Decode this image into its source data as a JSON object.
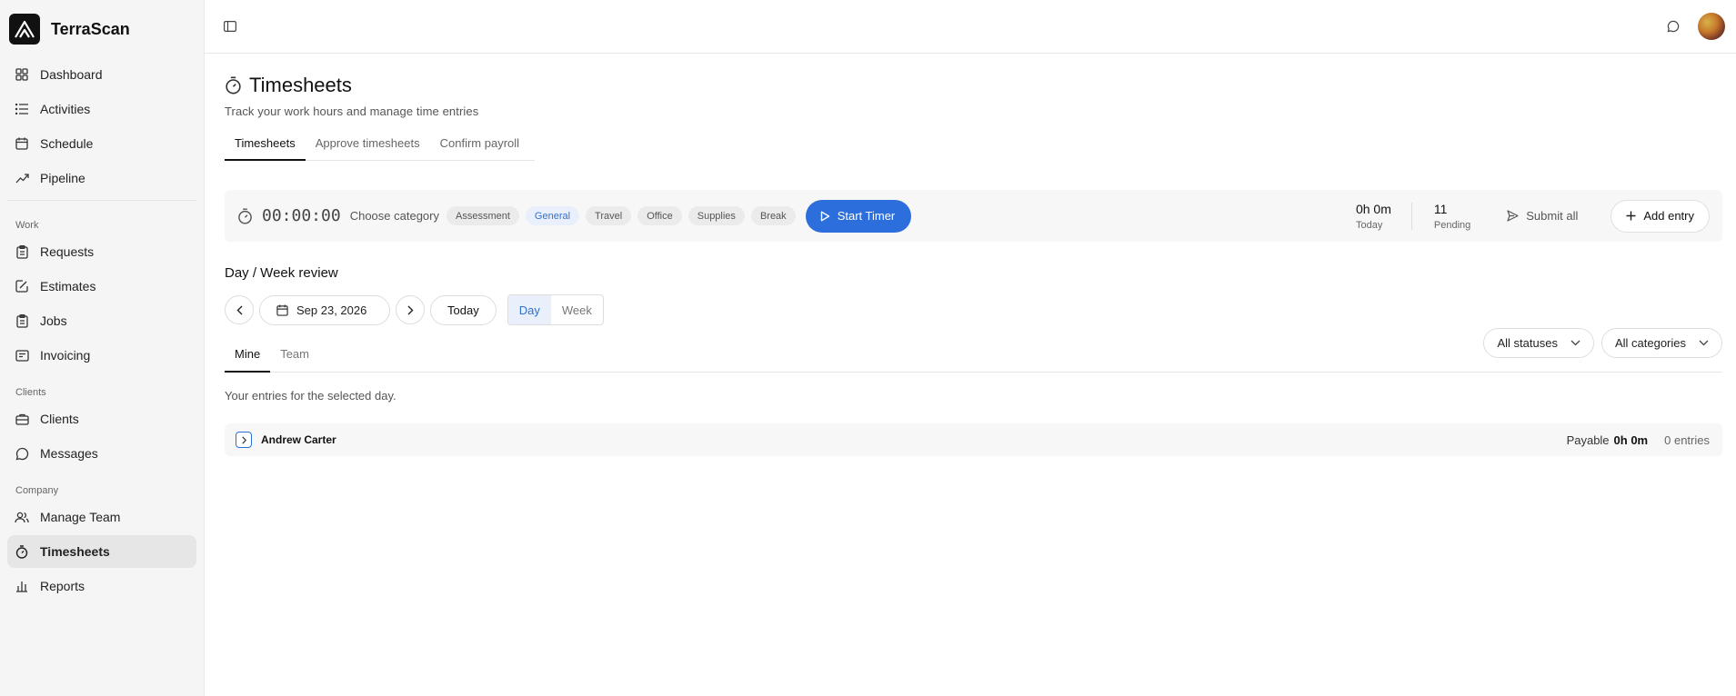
{
  "app": {
    "name": "TerraScan"
  },
  "sidebar": {
    "top_items": [
      {
        "label": "Dashboard",
        "icon": "grid-icon"
      },
      {
        "label": "Activities",
        "icon": "list-icon"
      },
      {
        "label": "Schedule",
        "icon": "calendar-icon"
      },
      {
        "label": "Pipeline",
        "icon": "trend-icon"
      }
    ],
    "work_label": "Work",
    "work_items": [
      {
        "label": "Requests",
        "icon": "clipboard-icon"
      },
      {
        "label": "Estimates",
        "icon": "estimate-icon"
      },
      {
        "label": "Jobs",
        "icon": "clipboard-icon"
      },
      {
        "label": "Invoicing",
        "icon": "invoice-icon"
      }
    ],
    "clients_label": "Clients",
    "clients_items": [
      {
        "label": "Clients",
        "icon": "briefcase-icon"
      },
      {
        "label": "Messages",
        "icon": "message-icon"
      }
    ],
    "company_label": "Company",
    "company_items": [
      {
        "label": "Manage Team",
        "icon": "users-icon"
      },
      {
        "label": "Timesheets",
        "icon": "stopwatch-icon"
      },
      {
        "label": "Reports",
        "icon": "bar-chart-icon"
      }
    ],
    "active": "Timesheets"
  },
  "page": {
    "title": "Timesheets",
    "subtitle": "Track your work hours and manage time entries",
    "tabs": [
      "Timesheets",
      "Approve timesheets",
      "Confirm payroll"
    ],
    "active_tab": "Timesheets"
  },
  "timer": {
    "display": "00:00:00",
    "choose_category_label": "Choose category",
    "categories": [
      "Assessment",
      "General",
      "Travel",
      "Office",
      "Supplies",
      "Break"
    ],
    "selected_category": "General",
    "start_label": "Start Timer",
    "today_value": "0h 0m",
    "today_label": "Today",
    "pending_value": "11",
    "pending_label": "Pending",
    "submit_all_label": "Submit all",
    "add_entry_label": "Add entry"
  },
  "review": {
    "title": "Day / Week review",
    "date": "Sep 23, 2026",
    "today_label": "Today",
    "view_options": [
      "Day",
      "Week"
    ],
    "active_view": "Day",
    "sub_tabs": [
      "Mine",
      "Team"
    ],
    "active_sub_tab": "Mine",
    "status_filter": "All statuses",
    "category_filter": "All categories",
    "caption": "Your entries for the selected day.",
    "entries": [
      {
        "name": "Andrew Carter",
        "payable_label": "Payable",
        "payable_hours": "0h 0m",
        "entries_count": "0 entries"
      }
    ]
  },
  "colors": {
    "accent": "#2c6fdc",
    "sidebar_bg": "#f5f5f5"
  }
}
